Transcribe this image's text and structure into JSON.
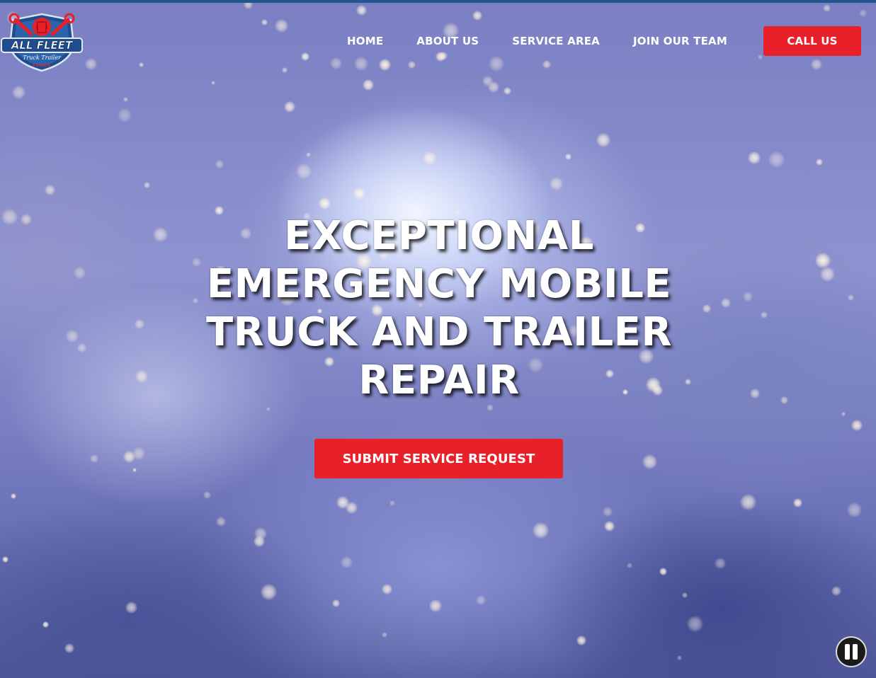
{
  "brand": {
    "logo_name": "All Fleet Truck & Trailer Repair logo",
    "logo_text_main": "ALL FLEET",
    "logo_text_script": "Truck Trailer",
    "logo_text_sub": "REPAIR"
  },
  "nav": {
    "items": [
      {
        "label": "HOME"
      },
      {
        "label": "ABOUT US"
      },
      {
        "label": "SERVICE AREA"
      },
      {
        "label": "JOIN OUR TEAM"
      }
    ],
    "call_label": "CALL US"
  },
  "hero": {
    "headline_lines": [
      "EXCEPTIONAL",
      "EMERGENCY MOBILE",
      "TRUCK AND TRAILER",
      "REPAIR"
    ],
    "cta_label": "SUBMIT SERVICE REQUEST",
    "video_control": "pause-icon"
  },
  "colors": {
    "accent_red": "#e8202a",
    "top_strip": "#24558f",
    "nav_text": "#ffffff"
  }
}
